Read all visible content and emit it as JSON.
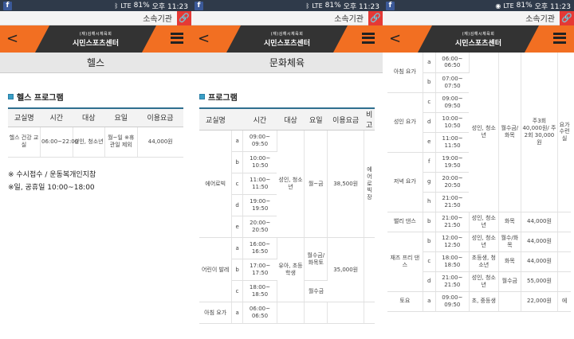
{
  "status": {
    "carrier": "LTE",
    "battery": "81%",
    "time": "오후 11:23"
  },
  "topbar": {
    "org_label": "소속기관"
  },
  "logo": {
    "small": "(재)김해시체육회",
    "large": "시민스포츠센터"
  },
  "panel1": {
    "page_title": "헬스",
    "section_title": "헬스 프로그램",
    "headers": [
      "교실명",
      "시간",
      "대상",
      "요일",
      "이용요금"
    ],
    "row": {
      "name": "헬스 건강 교실",
      "time": "06:00~22:00",
      "target": "성인, 청소년",
      "days": "월~일 ※휴관일 제외",
      "fee": "44,000원"
    },
    "notes": [
      "※ 수시접수 / 운동복개인지참",
      "※일, 공휴일 10:00~18:00"
    ]
  },
  "panel2": {
    "page_title": "문화체육",
    "section_title": "프로그램",
    "headers": [
      "교실명",
      "시간",
      "대상",
      "요일",
      "이용요금",
      "비고"
    ],
    "aerobic": {
      "name": "에어로빅",
      "target": "성인, 청소년",
      "days": "월~금",
      "fee": "38,500원",
      "note": "에어로빅장",
      "slots": [
        [
          "a",
          "09:00~ 09:50"
        ],
        [
          "b",
          "10:00~ 10:50"
        ],
        [
          "c",
          "11:00~ 11:50"
        ],
        [
          "d",
          "19:00~ 19:50"
        ],
        [
          "e",
          "20:00~ 20:50"
        ]
      ]
    },
    "ballet": {
      "name": "어린이 발레",
      "target": "유아, 초등학생",
      "days1": "월수금/화목토",
      "days2": "월수금",
      "fee": "35,000원",
      "slots": [
        [
          "a",
          "16:00~ 16:50"
        ],
        [
          "b",
          "17:00~ 17:50"
        ],
        [
          "c",
          "18:00~ 18:50"
        ]
      ]
    },
    "yoga_partial": {
      "name": "아침 요가",
      "slot": [
        "a",
        "06:00~ 06:50"
      ]
    }
  },
  "panel3": {
    "rows": [
      {
        "name": "아침 요가",
        "sub": "a",
        "time": "06:00~ 06:50"
      },
      {
        "name": "",
        "sub": "b",
        "time": "07:00~ 07:50"
      },
      {
        "name": "성인 요가",
        "sub": "c",
        "time": "09:00~ 09:50"
      },
      {
        "name": "",
        "sub": "d",
        "time": "10:00~ 10:50"
      },
      {
        "name": "",
        "sub": "e",
        "time": "11:00~ 11:50"
      },
      {
        "name": "저녁 요가",
        "sub": "f",
        "time": "19:00~ 19:50"
      },
      {
        "name": "",
        "sub": "g",
        "time": "20:00~ 20:50"
      },
      {
        "name": "",
        "sub": "h",
        "time": "21:00~ 21:50"
      }
    ],
    "yoga_target": "성인, 청소년",
    "yoga_days": "월수금/화목",
    "yoga_fee": "주3회 40,000원/ 주2회 30,000원",
    "yoga_note": "요가수련실",
    "belly": {
      "name": "밸리 댄스",
      "sub": "b",
      "time": "21:00~ 21:50",
      "target": "성인, 청소년",
      "days": "화목",
      "fee": "44,000원"
    },
    "jazz": {
      "name": "재즈 프리 댄스",
      "rows": [
        {
          "sub": "b",
          "time": "12:00~ 12:50",
          "target": "성인, 청소년",
          "days": "월수/화목",
          "fee": "44,000원"
        },
        {
          "sub": "c",
          "time": "18:00~ 18:50",
          "target": "초등생, 청소년",
          "days": "화목",
          "fee": "44,000원"
        },
        {
          "sub": "d",
          "time": "21:00~ 21:50",
          "target": "성인, 청소년",
          "days": "월수금",
          "fee": "55,000원"
        }
      ]
    },
    "last": {
      "name": "토요",
      "sub": "a",
      "time": "09:00~ 09:50",
      "target": "초, 중등생",
      "fee": "22,000원",
      "note": "에"
    }
  }
}
